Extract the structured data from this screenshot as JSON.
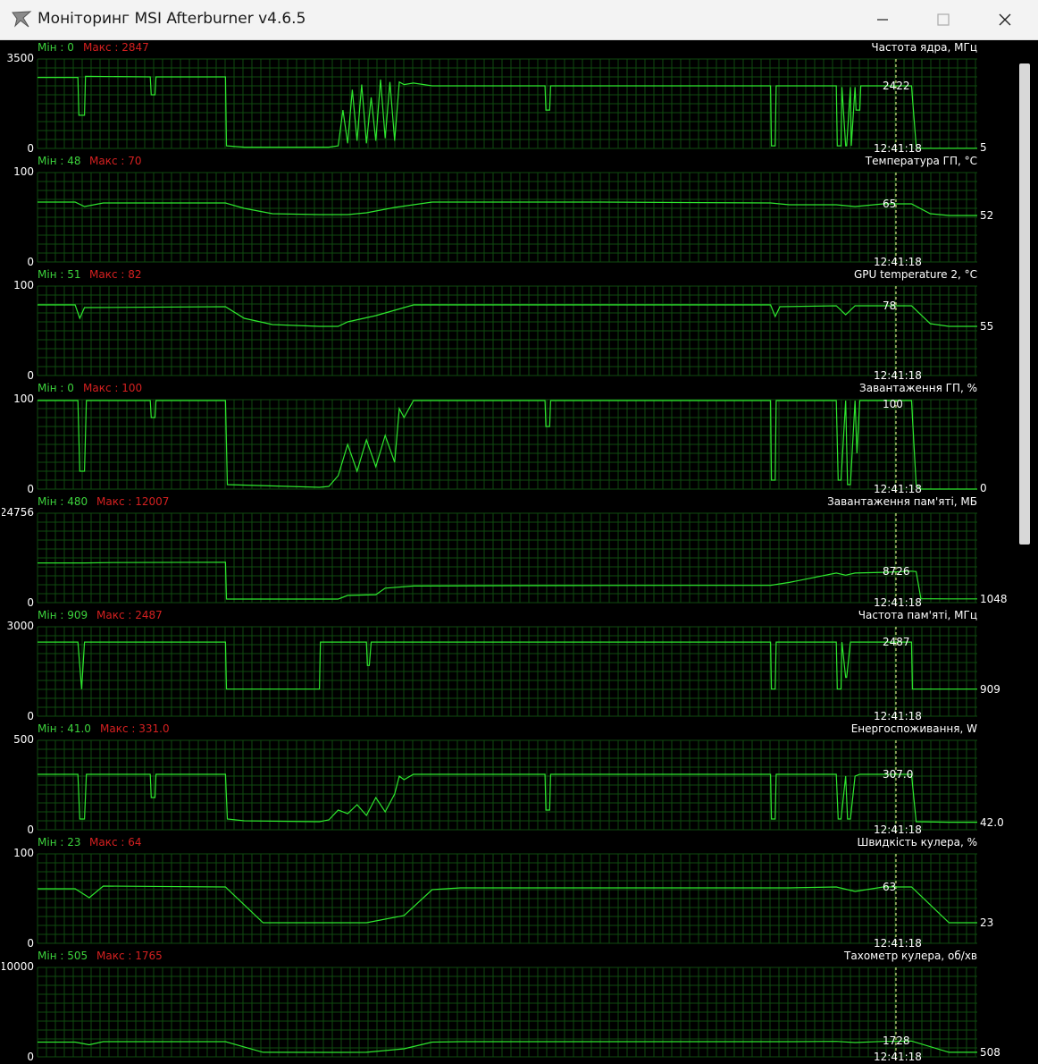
{
  "window": {
    "title": "Моніторинг MSI Afterburner v4.6.5",
    "icons": {
      "app": "afterburner-plane-icon",
      "minimize": "minimize-icon",
      "maximize": "maximize-icon",
      "close": "close-icon"
    }
  },
  "colors": {
    "background": "#000000",
    "grid": "#0f4a0f",
    "line": "#2ee62e",
    "min_text": "#3cd23c",
    "max_text": "#d42020",
    "cursor": "#ffffa0"
  },
  "cursor_time": "12:41:18",
  "graphs": [
    {
      "title": "Частота ядра, МГц",
      "min_label": "Мін : 0",
      "max_label": "Макс : 2847",
      "y_max": "3500",
      "y_min": "0",
      "current": "2422",
      "last": "5"
    },
    {
      "title": "Температура ГП, °C",
      "min_label": "Мін : 48",
      "max_label": "Макс : 70",
      "y_max": "100",
      "y_min": "0",
      "current": "65",
      "last": "52"
    },
    {
      "title": "GPU temperature 2, °C",
      "min_label": "Мін : 51",
      "max_label": "Макс : 82",
      "y_max": "100",
      "y_min": "0",
      "current": "78",
      "last": "55"
    },
    {
      "title": "Завантаження ГП, %",
      "min_label": "Мін : 0",
      "max_label": "Макс : 100",
      "y_max": "100",
      "y_min": "0",
      "current": "100",
      "last": "0"
    },
    {
      "title": "Завантаження пам'яті, МБ",
      "min_label": "Мін : 480",
      "max_label": "Макс : 12007",
      "y_max": "24756",
      "y_min": "0",
      "current": "8726",
      "last": "1048"
    },
    {
      "title": "Частота пам'яті, МГц",
      "min_label": "Мін : 909",
      "max_label": "Макс : 2487",
      "y_max": "3000",
      "y_min": "0",
      "current": "2487",
      "last": "909"
    },
    {
      "title": "Енергоспоживання, W",
      "min_label": "Мін : 41.0",
      "max_label": "Макс : 331.0",
      "y_max": "500",
      "y_min": "0",
      "current": "307.0",
      "last": "42.0"
    },
    {
      "title": "Швидкість кулера, %",
      "min_label": "Мін : 23",
      "max_label": "Макс : 64",
      "y_max": "100",
      "y_min": "0",
      "current": "63",
      "last": "23"
    },
    {
      "title": "Тахометр кулера, об/хв",
      "min_label": "Мін : 505",
      "max_label": "Макс : 1765",
      "y_max": "10000",
      "y_min": "0",
      "current": "1728",
      "last": "508"
    }
  ],
  "chart_data": [
    {
      "type": "line",
      "title": "Частота ядра, МГц",
      "ylim": [
        0,
        3500
      ],
      "series": [
        {
          "x": [
            0,
            0.043,
            0.044,
            0.05,
            0.051,
            0.12,
            0.121,
            0.125,
            0.126,
            0.2,
            0.201,
            0.22,
            0.31,
            0.32,
            0.325,
            0.33,
            0.335,
            0.34,
            0.345,
            0.35,
            0.355,
            0.36,
            0.365,
            0.37,
            0.375,
            0.38,
            0.385,
            0.39,
            0.4,
            0.42,
            0.54,
            0.541,
            0.545,
            0.546,
            0.7,
            0.78,
            0.781,
            0.785,
            0.786,
            0.85,
            0.851,
            0.855,
            0.856,
            0.86,
            0.861,
            0.865,
            0.866,
            0.87,
            0.871,
            0.875,
            0.876,
            0.88,
            0.9,
            0.93,
            0.935,
            0.936,
            0.97,
            1
          ],
          "y": [
            2780,
            2780,
            1300,
            1300,
            2820,
            2800,
            2100,
            2100,
            2800,
            2800,
            100,
            50,
            50,
            100,
            1500,
            200,
            2300,
            300,
            2500,
            200,
            2000,
            300,
            2700,
            400,
            2600,
            300,
            2600,
            2500,
            2560,
            2450,
            2450,
            1500,
            1500,
            2450,
            2450,
            2450,
            100,
            100,
            2450,
            2450,
            100,
            100,
            2400,
            100,
            100,
            2400,
            100,
            2400,
            1500,
            1500,
            2450,
            2450,
            2450,
            2450,
            100,
            5,
            5,
            5
          ]
        }
      ]
    },
    {
      "type": "line",
      "title": "Температура ГП, °C",
      "ylim": [
        0,
        100
      ],
      "series": [
        {
          "x": [
            0,
            0.04,
            0.05,
            0.07,
            0.2,
            0.22,
            0.25,
            0.3,
            0.33,
            0.35,
            0.38,
            0.42,
            0.45,
            0.6,
            0.78,
            0.8,
            0.85,
            0.87,
            0.9,
            0.93,
            0.95,
            0.97,
            1
          ],
          "y": [
            67,
            67,
            62,
            66,
            66,
            60,
            54,
            53,
            53,
            55,
            61,
            67,
            67,
            67,
            66,
            64,
            64,
            62,
            65,
            65,
            54,
            52,
            52
          ]
        }
      ]
    },
    {
      "type": "line",
      "title": "GPU temperature 2, °C",
      "ylim": [
        0,
        100
      ],
      "series": [
        {
          "x": [
            0,
            0.04,
            0.045,
            0.05,
            0.2,
            0.22,
            0.25,
            0.3,
            0.32,
            0.33,
            0.36,
            0.38,
            0.4,
            0.45,
            0.6,
            0.78,
            0.785,
            0.79,
            0.85,
            0.86,
            0.87,
            0.9,
            0.93,
            0.95,
            0.97,
            1
          ],
          "y": [
            79,
            79,
            64,
            76,
            77,
            64,
            57,
            55,
            55,
            60,
            67,
            73,
            79,
            79,
            79,
            79,
            66,
            77,
            78,
            68,
            78,
            78,
            78,
            58,
            55,
            55
          ]
        }
      ]
    },
    {
      "type": "line",
      "title": "Завантаження ГП, %",
      "ylim": [
        0,
        100
      ],
      "series": [
        {
          "x": [
            0,
            0.043,
            0.045,
            0.05,
            0.052,
            0.12,
            0.121,
            0.125,
            0.126,
            0.2,
            0.202,
            0.3,
            0.31,
            0.32,
            0.33,
            0.34,
            0.35,
            0.36,
            0.37,
            0.38,
            0.385,
            0.39,
            0.4,
            0.42,
            0.54,
            0.541,
            0.545,
            0.546,
            0.78,
            0.781,
            0.785,
            0.786,
            0.85,
            0.852,
            0.855,
            0.86,
            0.862,
            0.865,
            0.87,
            0.872,
            0.875,
            0.93,
            0.935,
            0.94,
            0.97,
            1
          ],
          "y": [
            99,
            99,
            20,
            20,
            99,
            99,
            80,
            80,
            99,
            99,
            5,
            2,
            3,
            15,
            50,
            20,
            55,
            25,
            60,
            30,
            90,
            80,
            99,
            99,
            99,
            70,
            70,
            99,
            99,
            10,
            10,
            99,
            99,
            10,
            10,
            99,
            5,
            5,
            99,
            40,
            99,
            99,
            5,
            0,
            0,
            0
          ]
        }
      ]
    },
    {
      "type": "line",
      "title": "Завантаження пам'яті, МБ",
      "ylim": [
        0,
        24756
      ],
      "series": [
        {
          "x": [
            0,
            0.05,
            0.08,
            0.2,
            0.201,
            0.25,
            0.32,
            0.33,
            0.36,
            0.37,
            0.4,
            0.5,
            0.6,
            0.78,
            0.8,
            0.85,
            0.86,
            0.87,
            0.9,
            0.93,
            0.935,
            0.94,
            0.97,
            1
          ],
          "y": [
            11000,
            11000,
            11100,
            11200,
            1000,
            1000,
            1000,
            2000,
            2200,
            4000,
            4600,
            4700,
            4750,
            4800,
            5600,
            8200,
            7600,
            8200,
            8400,
            8726,
            8600,
            1100,
            1048,
            1048
          ]
        }
      ]
    },
    {
      "type": "line",
      "title": "Частота пам'яті, МГц",
      "ylim": [
        0,
        3000
      ],
      "series": [
        {
          "x": [
            0,
            0.043,
            0.047,
            0.05,
            0.2,
            0.201,
            0.3,
            0.301,
            0.35,
            0.351,
            0.353,
            0.355,
            0.78,
            0.781,
            0.785,
            0.786,
            0.85,
            0.851,
            0.855,
            0.856,
            0.86,
            0.861,
            0.865,
            0.866,
            0.9,
            0.93,
            0.931,
            1
          ],
          "y": [
            2487,
            2487,
            909,
            2487,
            2487,
            909,
            909,
            2487,
            2487,
            1700,
            1700,
            2487,
            2487,
            909,
            909,
            2487,
            2487,
            909,
            909,
            2487,
            1300,
            1300,
            2487,
            2487,
            2487,
            2487,
            909,
            909
          ]
        }
      ]
    },
    {
      "type": "line",
      "title": "Енергоспоживання, W",
      "ylim": [
        0,
        500
      ],
      "series": [
        {
          "x": [
            0,
            0.043,
            0.045,
            0.05,
            0.052,
            0.12,
            0.121,
            0.125,
            0.126,
            0.2,
            0.202,
            0.22,
            0.3,
            0.31,
            0.32,
            0.33,
            0.34,
            0.35,
            0.36,
            0.37,
            0.38,
            0.385,
            0.39,
            0.4,
            0.54,
            0.541,
            0.545,
            0.546,
            0.78,
            0.781,
            0.785,
            0.786,
            0.85,
            0.852,
            0.855,
            0.86,
            0.862,
            0.865,
            0.87,
            0.875,
            0.93,
            0.935,
            0.97,
            1
          ],
          "y": [
            310,
            310,
            60,
            60,
            310,
            310,
            180,
            180,
            310,
            310,
            60,
            50,
            45,
            55,
            110,
            90,
            140,
            80,
            180,
            100,
            200,
            300,
            280,
            310,
            310,
            110,
            110,
            310,
            310,
            60,
            60,
            310,
            310,
            60,
            60,
            300,
            60,
            60,
            300,
            310,
            310,
            45,
            42,
            42
          ]
        }
      ]
    },
    {
      "type": "line",
      "title": "Швидкість кулера, %",
      "ylim": [
        0,
        100
      ],
      "series": [
        {
          "x": [
            0,
            0.04,
            0.055,
            0.07,
            0.2,
            0.24,
            0.3,
            0.32,
            0.35,
            0.39,
            0.42,
            0.45,
            0.6,
            0.8,
            0.85,
            0.87,
            0.9,
            0.93,
            0.97,
            1
          ],
          "y": [
            61,
            61,
            51,
            64,
            63,
            23,
            23,
            23,
            23,
            31,
            60,
            62,
            62,
            62,
            63,
            58,
            63,
            63,
            23,
            23
          ]
        }
      ]
    },
    {
      "type": "line",
      "title": "Тахометр кулера, об/хв",
      "ylim": [
        0,
        10000
      ],
      "series": [
        {
          "x": [
            0,
            0.04,
            0.055,
            0.07,
            0.2,
            0.24,
            0.3,
            0.32,
            0.35,
            0.39,
            0.42,
            0.45,
            0.6,
            0.8,
            0.85,
            0.87,
            0.9,
            0.93,
            0.97,
            1
          ],
          "y": [
            1650,
            1650,
            1350,
            1700,
            1700,
            510,
            505,
            505,
            510,
            900,
            1650,
            1700,
            1700,
            1700,
            1728,
            1600,
            1728,
            1765,
            508,
            508
          ]
        }
      ]
    }
  ]
}
